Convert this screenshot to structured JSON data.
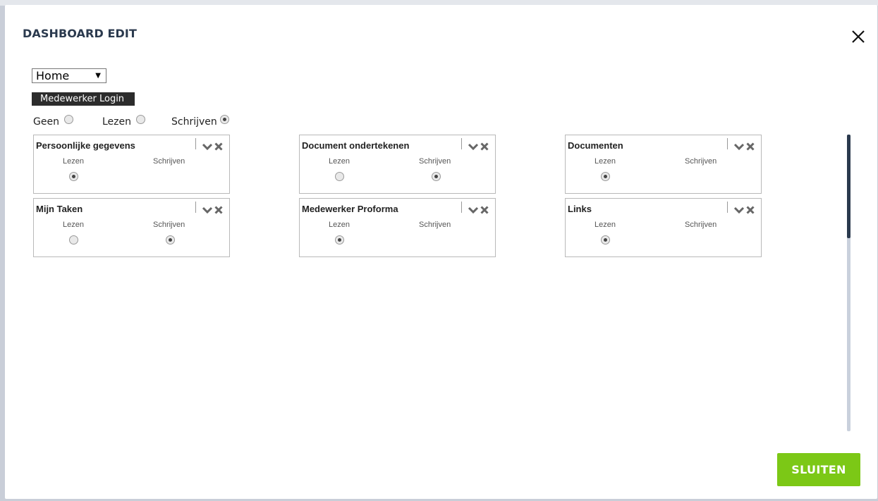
{
  "modal": {
    "title": "DASHBOARD EDIT",
    "close_icon": "close-icon",
    "page_select": {
      "value": "Home"
    },
    "role": "Medewerker Login",
    "permissions": {
      "options": [
        "Geen",
        "Lezen",
        "Schrijven"
      ],
      "selected": "Schrijven"
    },
    "option_labels": {
      "read": "Lezen",
      "write": "Schrijven"
    },
    "widgets": [
      {
        "title": "Persoonlijke gegevens",
        "read": true,
        "write": null
      },
      {
        "title": "Document ondertekenen",
        "read": false,
        "write": true
      },
      {
        "title": "Documenten",
        "read": true,
        "write": null
      },
      {
        "title": "Mijn Taken",
        "read": false,
        "write": true
      },
      {
        "title": "Medewerker Proforma",
        "read": true,
        "write": null
      },
      {
        "title": "Links",
        "read": true,
        "write": null
      }
    ],
    "footer": {
      "close_button": "SLUITEN"
    },
    "colors": {
      "accent": "#7cc816",
      "title": "#2b3a4e",
      "role_bg": "#2c2c2c"
    }
  }
}
